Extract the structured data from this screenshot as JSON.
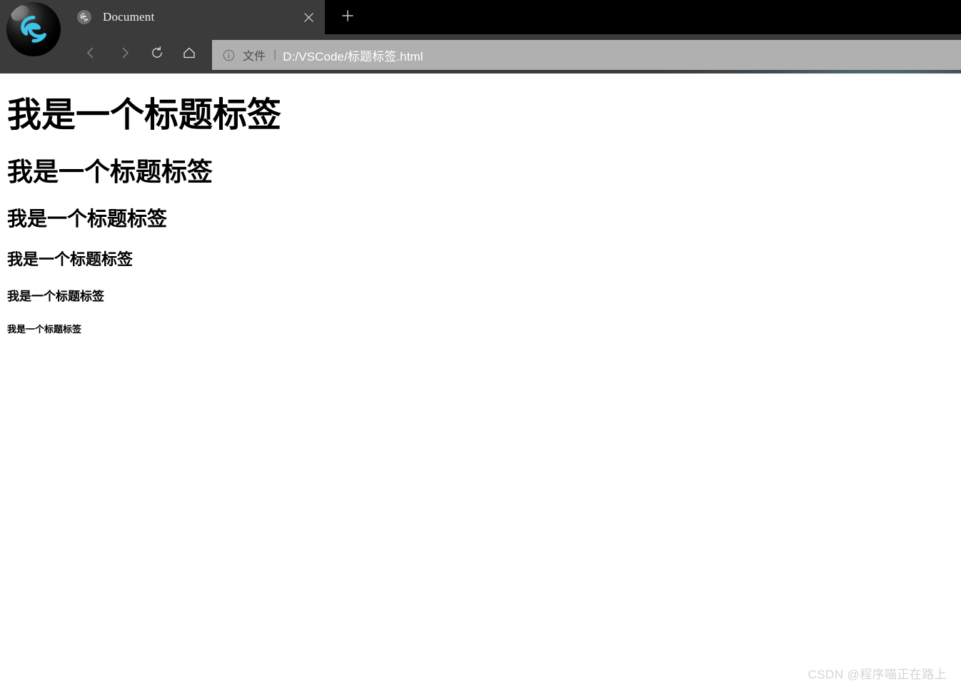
{
  "browser": {
    "logo_icon": "browser-logo-icon",
    "tab": {
      "favicon": "edge-favicon-icon",
      "title": "Document",
      "close_icon": "close-icon"
    },
    "new_tab_icon": "plus-icon",
    "toolbar": {
      "back_icon": "back-arrow-icon",
      "forward_icon": "forward-arrow-icon",
      "reload_icon": "reload-icon",
      "home_icon": "home-icon"
    },
    "address_bar": {
      "info_icon": "info-circle-icon",
      "scheme_label": "文件",
      "separator": "|",
      "url": "D:/VSCode/标题标签.html"
    },
    "colors": {
      "chrome_bg": "#3b3b3b",
      "tabstrip_bg": "#000000",
      "address_bg": "#b0b0b0",
      "accent_glow": "#78becd",
      "logo_accent": "#3fc3e8"
    }
  },
  "page": {
    "headings": [
      {
        "level": "h1",
        "text": "我是一个标题标签"
      },
      {
        "level": "h2",
        "text": "我是一个标题标签"
      },
      {
        "level": "h3",
        "text": "我是一个标题标签"
      },
      {
        "level": "h4",
        "text": "我是一个标题标签"
      },
      {
        "level": "h5",
        "text": "我是一个标题标签"
      },
      {
        "level": "h6",
        "text": "我是一个标题标签"
      }
    ],
    "watermark": "CSDN @程序喵正在路上"
  }
}
